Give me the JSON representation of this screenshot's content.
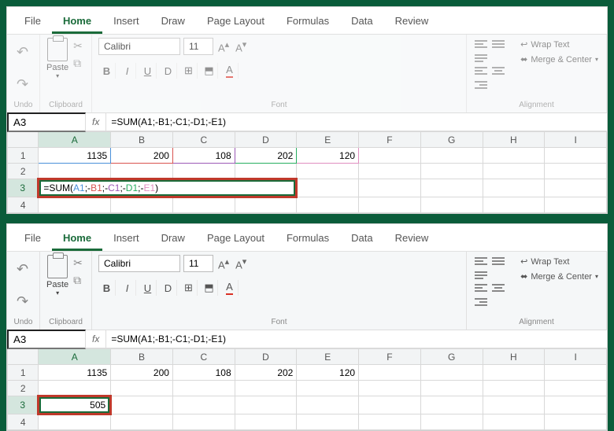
{
  "tabs": [
    "File",
    "Home",
    "Insert",
    "Draw",
    "Page Layout",
    "Formulas",
    "Data",
    "Review"
  ],
  "active_tab": "Home",
  "clipboard": {
    "paste": "Paste",
    "label": "Clipboard"
  },
  "undo_label": "Undo",
  "font": {
    "name": "Calibri",
    "size": "11",
    "label": "Font",
    "bold": "B",
    "italic": "I",
    "underline": "U",
    "strike": "D"
  },
  "align": {
    "label": "Alignment",
    "wrap": "Wrap Text",
    "merge": "Merge & Center"
  },
  "namebox": "A3",
  "formula": "=SUM(A1;-B1;-C1;-D1;-E1)",
  "formula_parts": {
    "pre": "=SUM(",
    "a": "A1",
    "s1": ";-",
    "b": "B1",
    "s2": ";-",
    "c": "C1",
    "s3": ";-",
    "d": "D1",
    "s4": ";-",
    "e": "E1",
    "post": ")"
  },
  "columns": [
    "A",
    "B",
    "C",
    "D",
    "E",
    "F",
    "G",
    "H",
    "I"
  ],
  "row1": {
    "a": "1135",
    "b": "200",
    "c": "108",
    "d": "202",
    "e": "120"
  },
  "result": "505",
  "chart_data": {
    "type": "table",
    "rows": [
      {
        "A": 1135,
        "B": 200,
        "C": 108,
        "D": 202,
        "E": 120
      },
      {
        "A": "=SUM(A1;-B1;-C1;-D1;-E1)",
        "result": 505
      }
    ]
  }
}
